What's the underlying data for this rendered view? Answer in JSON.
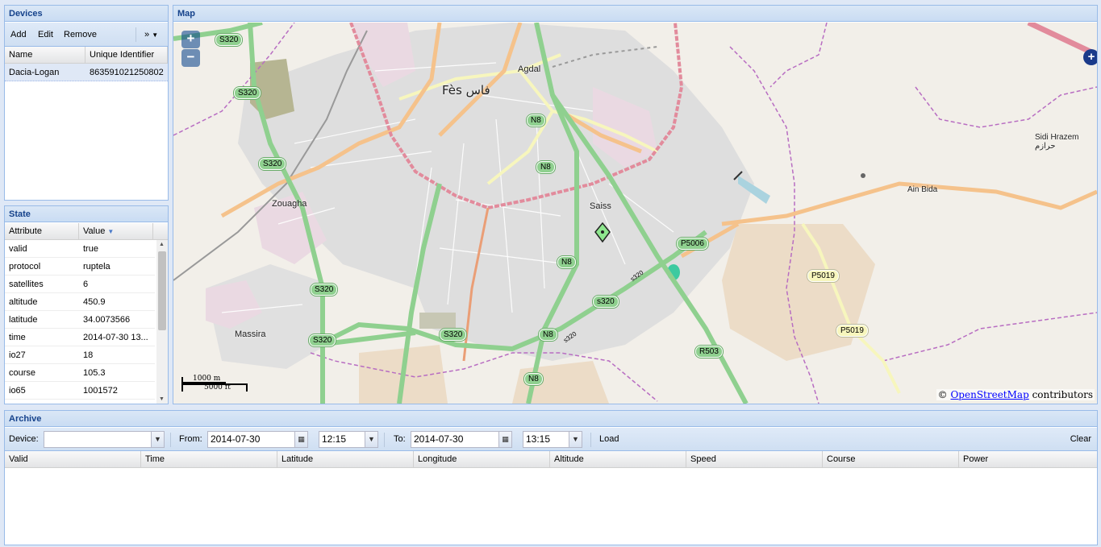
{
  "devices": {
    "title": "Devices",
    "add": "Add",
    "edit": "Edit",
    "remove": "Remove",
    "more": "»",
    "columns": [
      "Name",
      "Unique Identifier"
    ],
    "rows": [
      {
        "name": "Dacia-Logan",
        "uid": "863591021250802"
      }
    ]
  },
  "state": {
    "title": "State",
    "columns": [
      "Attribute",
      "Value"
    ],
    "rows": [
      {
        "attr": "valid",
        "value": "true"
      },
      {
        "attr": "protocol",
        "value": "ruptela"
      },
      {
        "attr": "satellites",
        "value": "6"
      },
      {
        "attr": "altitude",
        "value": "450.9"
      },
      {
        "attr": "latitude",
        "value": "34.0073566"
      },
      {
        "attr": "time",
        "value": "2014-07-30 13..."
      },
      {
        "attr": "io27",
        "value": "18"
      },
      {
        "attr": "course",
        "value": "105.3"
      },
      {
        "attr": "io65",
        "value": "1001572"
      }
    ]
  },
  "map": {
    "title": "Map",
    "zoom_in": "+",
    "zoom_out": "−",
    "scale_m": "1000 m",
    "scale_ft": "5000 ft",
    "attribution_prefix": "©",
    "attribution_link": "OpenStreetMap",
    "attribution_suffix": "contributors",
    "places": {
      "fes": "Fès فاس",
      "agdal": "Agdal",
      "zouagha": "Zouagha",
      "saiss": "Saiss",
      "massira": "Massira",
      "ain_bida": "Ain Bida",
      "sidi_hrazem": "Sidi Hrazem حرازم"
    },
    "shields": {
      "s320": "S320",
      "n8": "N8",
      "p5006": "P5006",
      "p5019": "P5019",
      "r503": "R503",
      "s320_lower": "s320"
    },
    "road_labels": {
      "s320": "s320"
    },
    "colors": {
      "land": "#f2efe9",
      "urban": "#ddd",
      "motorway": "#e892a2",
      "trunk": "#8fd08f",
      "primary": "#fcd6a4",
      "secondary": "#f7fabf"
    }
  },
  "archive": {
    "title": "Archive",
    "device_label": "Device:",
    "device_value": "",
    "from_label": "From:",
    "from_date": "2014-07-30",
    "from_time": "12:15",
    "to_label": "To:",
    "to_date": "2014-07-30",
    "to_time": "13:15",
    "load": "Load",
    "clear": "Clear",
    "columns": [
      "Valid",
      "Time",
      "Latitude",
      "Longitude",
      "Altitude",
      "Speed",
      "Course",
      "Power"
    ]
  }
}
